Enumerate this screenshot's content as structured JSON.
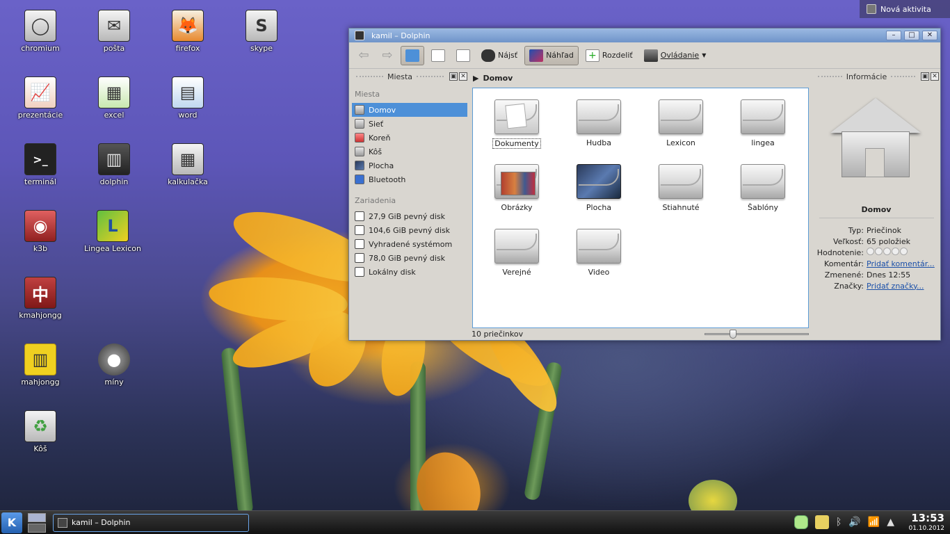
{
  "desktop": {
    "icons": [
      {
        "label": "chromium"
      },
      {
        "label": "pošta"
      },
      {
        "label": "firefox"
      },
      {
        "label": "skype"
      },
      {
        "label": "prezentácie"
      },
      {
        "label": "excel"
      },
      {
        "label": "word"
      },
      {
        "label": "terminál"
      },
      {
        "label": "dolphin"
      },
      {
        "label": "kalkulačka"
      },
      {
        "label": "k3b"
      },
      {
        "label": "Lingea Lexicon"
      },
      {
        "label": "kmahjongg"
      },
      {
        "label": "mahjongg"
      },
      {
        "label": "míny"
      },
      {
        "label": "Kôš"
      }
    ],
    "activity_label": "Nová aktivita"
  },
  "window": {
    "title": "kamil – Dolphin",
    "buttons": {
      "minimize": "–",
      "maximize": "□",
      "close": "✕"
    }
  },
  "toolbar": {
    "back": "⇦",
    "forward": "⇨",
    "find": "Nájsť",
    "preview": "Náhľad",
    "split": "Rozdeliť",
    "control": "Ovládanie"
  },
  "places": {
    "title": "Miesta",
    "section_places": "Miesta",
    "items": [
      "Domov",
      "Sieť",
      "Koreň",
      "Kôš",
      "Plocha",
      "Bluetooth"
    ],
    "section_devices": "Zariadenia",
    "devices": [
      "27,9 GiB pevný disk",
      "104,6 GiB pevný disk",
      "Vyhradené systémom",
      "78,0 GiB pevný disk",
      "Lokálny disk"
    ]
  },
  "main": {
    "breadcrumb": "Domov",
    "folders": [
      "Dokumenty",
      "Hudba",
      "Lexicon",
      "lingea",
      "Obrázky",
      "Plocha",
      "Stiahnuté",
      "Šablóny",
      "Verejné",
      "Video"
    ],
    "status": "10 priečinkov",
    "zoom_level": 0.25
  },
  "info": {
    "title": "Informácie",
    "name": "Domov",
    "rows": {
      "type_k": "Typ:",
      "type_v": "Priečinok",
      "size_k": "Veľkosť:",
      "size_v": "65 položiek",
      "rating_k": "Hodnotenie:",
      "rating_v": 0,
      "comment_k": "Komentár:",
      "comment_v": "Pridať komentár...",
      "modified_k": "Zmenené:",
      "modified_v": "Dnes 12:55",
      "tags_k": "Značky:",
      "tags_v": "Pridať značky..."
    }
  },
  "taskbar": {
    "task": "kamil – Dolphin",
    "time": "13:53",
    "date": "01.10.2012"
  },
  "colors": {
    "selection": "#4d90d8",
    "titlebar": "#6f94c9"
  }
}
